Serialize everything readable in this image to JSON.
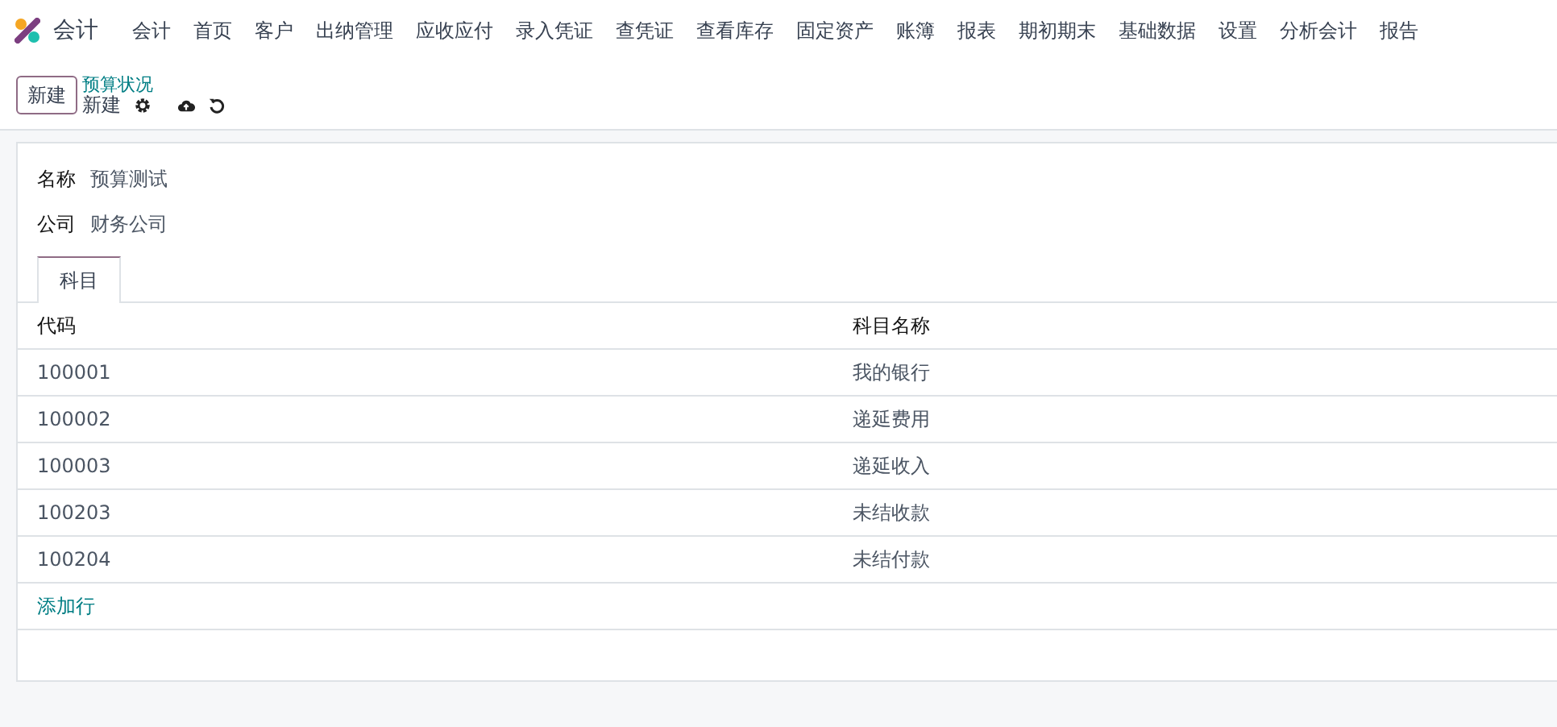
{
  "navbar": {
    "app_name": "会计",
    "menu": [
      "会计",
      "首页",
      "客户",
      "出纳管理",
      "应收应付",
      "录入凭证",
      "查凭证",
      "查看库存",
      "固定资产",
      "账簿",
      "报表",
      "期初期末",
      "基础数据",
      "设置",
      "分析会计",
      "报告"
    ]
  },
  "control_panel": {
    "new_button": "新建",
    "breadcrumb": "预算状况",
    "record_title": "新建"
  },
  "form": {
    "fields": [
      {
        "label": "名称",
        "value": "预算测试"
      },
      {
        "label": "公司",
        "value": "财务公司"
      }
    ],
    "tabs": [
      {
        "label": "科目",
        "selected": true
      }
    ],
    "table": {
      "columns": [
        "代码",
        "科目名称"
      ],
      "rows": [
        [
          "100001",
          "我的银行"
        ],
        [
          "100002",
          "递延费用"
        ],
        [
          "100003",
          "递延收入"
        ],
        [
          "100203",
          "未结收款"
        ],
        [
          "100204",
          "未结付款"
        ]
      ],
      "add_line": "添加行"
    }
  }
}
